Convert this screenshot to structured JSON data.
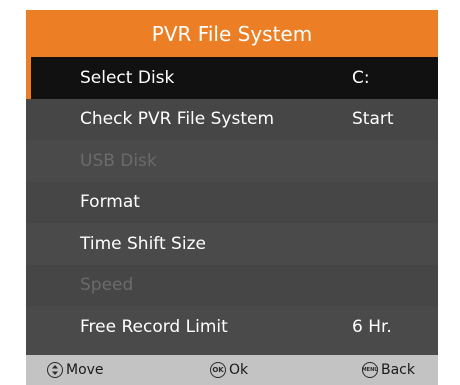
{
  "title": "PVR File System",
  "menu": [
    {
      "label": "Select Disk",
      "value": "C:",
      "state": "selected"
    },
    {
      "label": "Check PVR File System",
      "value": "Start",
      "state": "normal"
    },
    {
      "label": "USB Disk",
      "value": "",
      "state": "disabled"
    },
    {
      "label": "Format",
      "value": "",
      "state": "normal"
    },
    {
      "label": "Time Shift Size",
      "value": "",
      "state": "normal"
    },
    {
      "label": "Speed",
      "value": "",
      "state": "disabled"
    },
    {
      "label": "Free Record Limit",
      "value": "6 Hr.",
      "state": "normal"
    }
  ],
  "footer": {
    "move_label": "Move",
    "ok_label": "Ok",
    "ok_icon_text": "OK",
    "back_label": "Back",
    "back_icon_text": "MENU"
  },
  "colors": {
    "accent": "#ec7f25",
    "panel": "#4a4a4a",
    "selected_row": "#111111",
    "disabled_text": "#6b6b6b",
    "footer": "#c3c3c3"
  },
  "icons": [
    "updown-arrows-icon",
    "ok-button-icon",
    "menu-button-icon"
  ]
}
